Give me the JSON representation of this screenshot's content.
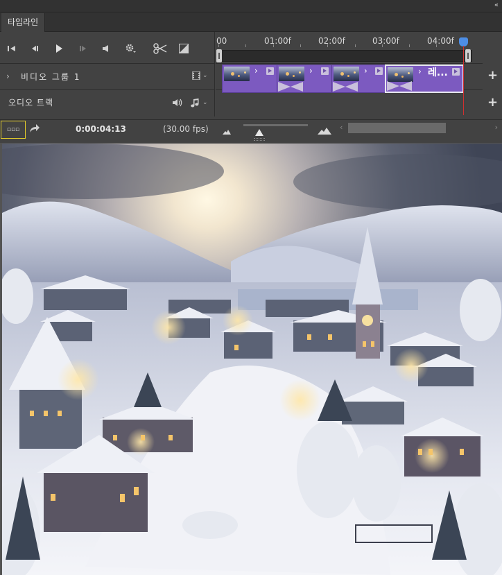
{
  "panel": {
    "collapse_icon": "«"
  },
  "tab": {
    "label": "타임라인"
  },
  "controls": {
    "icons": [
      "skip-to-start-icon",
      "previous-frame-icon",
      "play-icon",
      "next-frame-icon",
      "volume-icon",
      "settings-icon",
      "scissors-icon",
      "transition-icon"
    ]
  },
  "ruler": {
    "labels": [
      "00",
      "01:00f",
      "02:00f",
      "03:00f",
      "04:00f"
    ]
  },
  "tracks": {
    "video_group": {
      "chevron": "›",
      "name": "비디오 그룹 1"
    },
    "audio_track": {
      "name": "오디오 트랙"
    }
  },
  "clips": [
    {
      "chevron": "›",
      "label": "",
      "selected": false
    },
    {
      "chevron": "›",
      "label": "",
      "selected": false
    },
    {
      "chevron": "›",
      "label": "",
      "selected": false
    },
    {
      "chevron": "›",
      "label": "레...",
      "selected": true
    }
  ],
  "footer": {
    "timecode": "0:00:04:13",
    "fps": "(30.00 fps)",
    "render_button_glyph": "▫▫▫"
  },
  "colors": {
    "clip_purple": "#7c5ac0",
    "playhead_blue": "#4d8ee6",
    "playhead_red": "#d03030",
    "focus_yellow": "#e6cf2a"
  },
  "preview": {
    "description_icon": "winter-village-image"
  }
}
